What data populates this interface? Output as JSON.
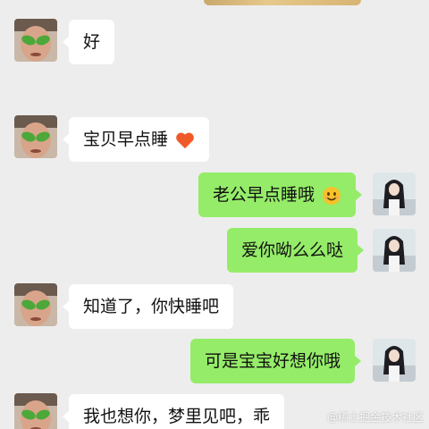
{
  "messages": [
    {
      "side": "left",
      "text": "好"
    },
    {
      "side": "left",
      "text": "宝贝早点睡",
      "emoji": "heart-icon"
    },
    {
      "side": "right",
      "text": "老公早点睡哦",
      "emoji": "smile-icon"
    },
    {
      "side": "right",
      "text": "爱你呦么么哒"
    },
    {
      "side": "left",
      "text": "知道了，你快睡吧"
    },
    {
      "side": "right",
      "text": "可是宝宝好想你哦"
    },
    {
      "side": "left",
      "text": "我也想你，梦里见吧，乖"
    }
  ],
  "watermark": "@稀土掘金技术社区",
  "colors": {
    "background": "#ededed",
    "bubble_self": "#95ec69",
    "bubble_other": "#ffffff",
    "heart": "#f05a28",
    "smile": "#f7c12a"
  },
  "icons": {
    "other_avatar": "alien-face-avatar",
    "self_avatar": "girl-photo-avatar"
  }
}
